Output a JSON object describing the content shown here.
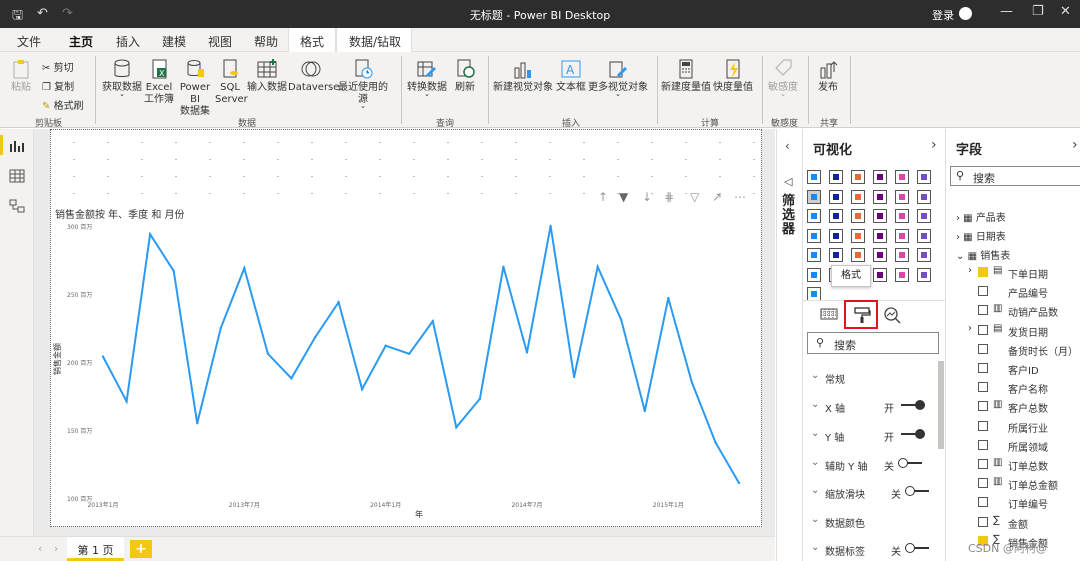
{
  "window": {
    "title": "无标题 - Power BI Desktop",
    "login": "登录"
  },
  "menu": {
    "items": [
      "文件",
      "主页",
      "插入",
      "建模",
      "视图",
      "帮助",
      "格式",
      "数据/钻取"
    ]
  },
  "ribbon": {
    "clipboard": {
      "paste": "粘贴",
      "cut": "剪切",
      "copy": "复制",
      "format_painter": "格式刷",
      "group": "剪贴板"
    },
    "data": {
      "get_data": "获取数据",
      "excel_1": "Excel",
      "excel_2": "工作簿",
      "pbi_1": "Power BI",
      "pbi_2": "数据集",
      "sql_1": "SQL",
      "sql_2": "Server",
      "enter": "输入数据",
      "dataverse": "Dataverse",
      "recent": "最近使用的源",
      "group": "数据"
    },
    "query": {
      "transform": "转换数据",
      "refresh": "刷新",
      "group": "查询"
    },
    "insert": {
      "new_visual": "新建视觉对象",
      "textbox": "文本框",
      "more_visuals": "更多视觉对象",
      "group": "插入"
    },
    "calc": {
      "new_measure": "新建度量值",
      "quick_measure": "快度量值",
      "group": "计算"
    },
    "sensitivity": {
      "label": "敏感度",
      "group": "敏感度"
    },
    "share": {
      "publish": "发布",
      "group": "共享"
    }
  },
  "chart_data": {
    "type": "line",
    "title": "销售金额按 年、季度 和 月份",
    "xlabel": "年",
    "ylabel": "销售金额",
    "ylim": [
      100,
      300
    ],
    "y_ticks": [
      "100 百万",
      "150 百万",
      "200 百万",
      "250 百万",
      "300 百万"
    ],
    "x_ticks": [
      "2013年1月",
      "2013年7月",
      "2014年1月",
      "2014年7月",
      "2015年1月"
    ],
    "x": [
      "2013-01",
      "2013-02",
      "2013-03",
      "2013-04",
      "2013-05",
      "2013-06",
      "2013-07",
      "2013-08",
      "2013-09",
      "2013-10",
      "2013-11",
      "2013-12",
      "2014-01",
      "2014-02",
      "2014-03",
      "2014-04",
      "2014-05",
      "2014-06",
      "2014-07",
      "2014-08",
      "2014-09",
      "2014-10",
      "2014-11",
      "2014-12",
      "2015-01",
      "2015-02",
      "2015-03",
      "2015-04"
    ],
    "values": [
      204,
      171,
      294,
      267,
      155,
      225,
      269,
      206,
      188,
      218,
      244,
      180,
      212,
      206,
      230,
      152,
      173,
      270,
      207,
      300,
      189,
      270,
      231,
      164,
      247,
      185,
      141,
      111
    ],
    "color": "#2b9af3",
    "grid": false
  },
  "canvas": {
    "page_tab": "第 1 页",
    "add_tab": "+"
  },
  "filters": {
    "label": "筛选器"
  },
  "viz_pane": {
    "title": "可视化",
    "tooltip": "格式",
    "search_placeholder": "搜索",
    "sections": [
      {
        "label": "常规",
        "state": ""
      },
      {
        "label": "X 轴",
        "state": "开"
      },
      {
        "label": "Y 轴",
        "state": "开"
      },
      {
        "label": "辅助 Y 轴",
        "state": "关"
      },
      {
        "label": "缩放滑块",
        "state": "关"
      },
      {
        "label": "数据颜色",
        "state": ""
      },
      {
        "label": "数据标签",
        "state": "关"
      }
    ]
  },
  "fields_pane": {
    "title": "字段",
    "search_placeholder": "搜索",
    "tables": [
      "产品表",
      "日期表",
      "销售表"
    ],
    "fields": [
      "下单日期",
      "产品编号",
      "动销产品数",
      "发货日期",
      "备货时长（月）",
      "客户ID",
      "客户名称",
      "客户总数",
      "所属行业",
      "所属领域",
      "订单总数",
      "订单总金额",
      "订单编号",
      "金额",
      "销售金额"
    ],
    "watermark": "CSDN @阿柯@"
  }
}
